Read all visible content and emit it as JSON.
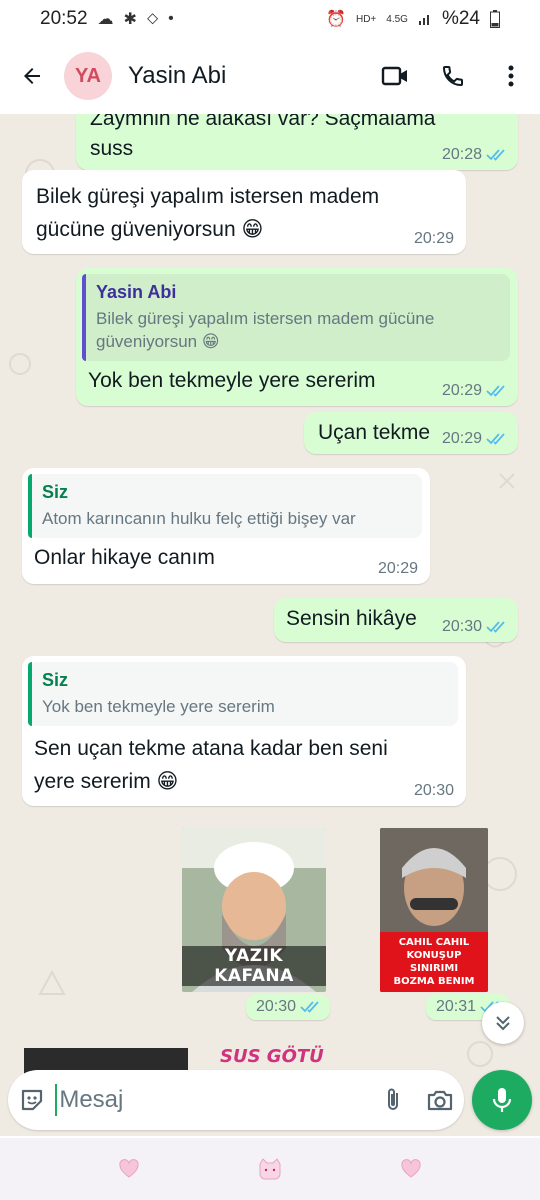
{
  "status_bar": {
    "time": "20:52",
    "battery": "%24",
    "network": "4.5G",
    "hd": "HD+"
  },
  "header": {
    "avatar_initials": "YA",
    "contact_name": "Yasin Abi"
  },
  "messages": [
    {
      "direction": "out",
      "text": "suss",
      "time": "20:28",
      "partial_top": "Zaymnin ne alakası var? Saçmalama"
    },
    {
      "direction": "in",
      "text_lines": [
        "Bilek güreşi yapalım istersen madem",
        "gücüne güveniyorsun 😁"
      ],
      "time": "20:29"
    },
    {
      "direction": "out",
      "quote_author": "Yasin Abi",
      "quote_text": "Bilek güreşi yapalım istersen madem gücüne güveniyorsun 😁",
      "text": "Yok ben tekmeyle yere sererim",
      "time": "20:29"
    },
    {
      "direction": "out",
      "text": "Uçan tekme",
      "time": "20:29"
    },
    {
      "direction": "in",
      "quote_author": "Siz",
      "quote_text": "Atom karıncanın hulku felç ettiği bişey var",
      "text": "Onlar hikaye canım",
      "time": "20:29"
    },
    {
      "direction": "out",
      "text": "Sensin hikâye",
      "time": "20:30"
    },
    {
      "direction": "in",
      "quote_author": "Siz",
      "quote_text": "Yok ben tekmeyle yere sererim",
      "text_lines": [
        "Sen uçan tekme atana kadar ben seni",
        "yere sererim 😁"
      ],
      "time": "20:30"
    }
  ],
  "stickers": [
    {
      "caption": "YAZIK KAFANA",
      "time": "20:30"
    },
    {
      "caption_lines": [
        "CAHIL CAHIL",
        "KONUŞUP SINIRIMI",
        "BOZMA BENIM"
      ],
      "time": "20:31"
    }
  ],
  "partial_sticker_text": "SUS GÖTÜ",
  "input": {
    "placeholder": "Mesaj"
  },
  "colors": {
    "outgoing_bubble": "#d9fdd3",
    "incoming_bubble": "#ffffff",
    "chat_bg": "#efeae2",
    "accent_green": "#1daa61",
    "read_ticks": "#53bdeb"
  }
}
